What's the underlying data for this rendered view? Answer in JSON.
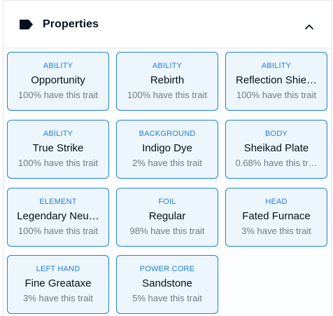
{
  "header": {
    "title": "Properties",
    "icon": "label-tag-icon",
    "toggle_icon": "chevron-up-icon"
  },
  "colors": {
    "accent": "#2081e2",
    "card_bg": "#ecf6fc",
    "muted_text": "#707a83",
    "text": "#04111d",
    "border": "#e5e8eb"
  },
  "traits": [
    {
      "type": "ABILITY",
      "value": "Opportunity",
      "rarity": "100% have this trait"
    },
    {
      "type": "ABILITY",
      "value": "Rebirth",
      "rarity": "100% have this trait"
    },
    {
      "type": "ABILITY",
      "value": "Reflection Shie…",
      "rarity": "100% have this trait"
    },
    {
      "type": "ABILITY",
      "value": "True Strike",
      "rarity": "100% have this trait"
    },
    {
      "type": "BACKGROUND",
      "value": "Indigo Dye",
      "rarity": "2% have this trait"
    },
    {
      "type": "BODY",
      "value": "Sheikad Plate",
      "rarity": "0.68% have this tr…"
    },
    {
      "type": "ELEMENT",
      "value": "Legendary Neu…",
      "rarity": "100% have this trait"
    },
    {
      "type": "FOIL",
      "value": "Regular",
      "rarity": "98% have this trait"
    },
    {
      "type": "HEAD",
      "value": "Fated Furnace",
      "rarity": "3% have this trait"
    },
    {
      "type": "LEFT HAND",
      "value": "Fine Greataxe",
      "rarity": "3% have this trait"
    },
    {
      "type": "POWER CORE",
      "value": "Sandstone",
      "rarity": "5% have this trait"
    }
  ]
}
